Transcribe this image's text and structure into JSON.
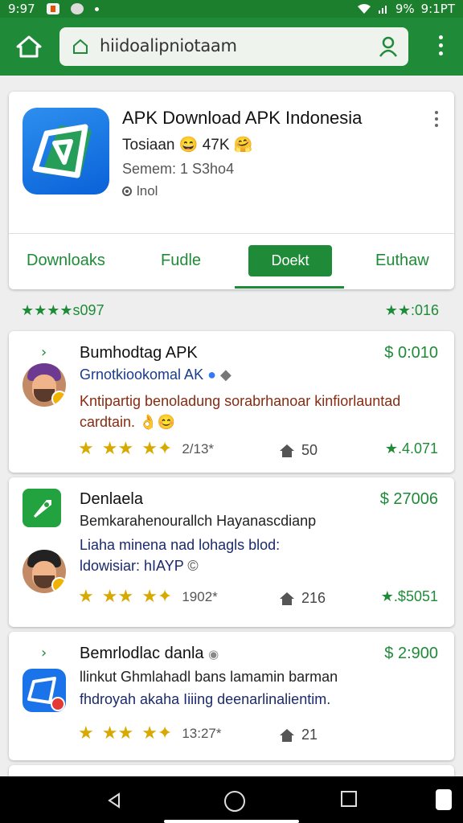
{
  "status": {
    "time_left": "9:97",
    "battery": "9%",
    "time_right": "9:1PT"
  },
  "browser": {
    "url": "hiidoalipniotaam"
  },
  "app": {
    "title": "APK Download APK Indonesia",
    "subtitle_prefix": "Tosiaan",
    "subtitle_count": "47K",
    "meta": "Semem: 1 S3ho4",
    "meta2": "lnol",
    "tabs": [
      {
        "label": "Downloaks"
      },
      {
        "label": "Fudle"
      },
      {
        "label": "Doekt"
      },
      {
        "label": "Euthaw"
      }
    ]
  },
  "summary": {
    "left": "★★★★s097",
    "right": "★★:016"
  },
  "items": [
    {
      "title": "Bumhodtag APK",
      "price": "$ 0:010",
      "publisher": "Grnotkiookomal AK",
      "description": "Kntipartig benoladung sorabrhanoar kinfiorlauntad cardtain.",
      "rating_count": "2/13*",
      "homes": "50",
      "footer": "★.4.071"
    },
    {
      "title": "Denlaela",
      "price": "$ 27006",
      "description1": "Bemkarahenourallch Hayanascdianp",
      "description2": "Liaha minena nad lohagls blod:",
      "description3": "ldowisiar: hIAYP",
      "rating_count": "1902*",
      "homes": "216",
      "footer": "★.$5051"
    },
    {
      "title": "Bemrlodlac danla",
      "price": "$ 2:900",
      "description1": "llinkut Ghmlahadl bans lamamin barman",
      "description2": "fhdroyah akaha Iiiing deenarlinalientim.",
      "rating_count": "13:27*",
      "homes": "21",
      "footer": ""
    }
  ],
  "colors": {
    "brand_green": "#1f8b38",
    "price_green": "#1f8b38",
    "star_gold": "#d8a900"
  }
}
